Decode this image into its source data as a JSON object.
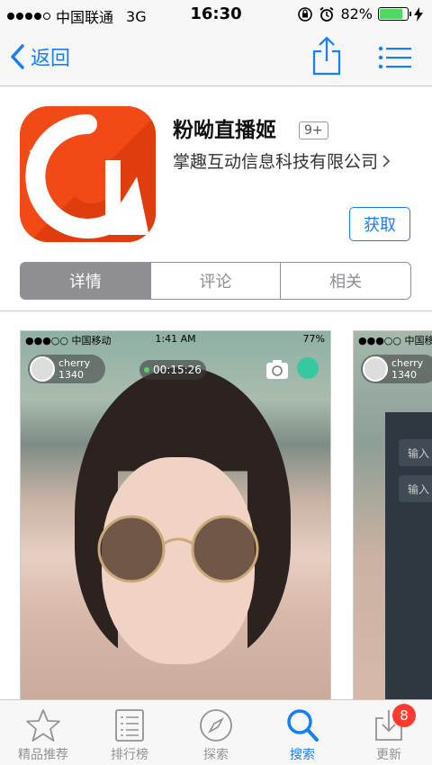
{
  "status_bar": {
    "carrier": "中国联通",
    "network": "3G",
    "time": "16:30",
    "battery": "82%",
    "battery_level": 0.82
  },
  "nav": {
    "back_label": "返回"
  },
  "app": {
    "name": "粉呦直播姬",
    "age_rating": "9+",
    "developer": "掌趣互动信息科技有限公司",
    "get_label": "获取"
  },
  "segments": [
    "详情",
    "评论",
    "相关"
  ],
  "screenshots": [
    {
      "carrier": "●●●○○ 中国移动",
      "time": "1:41 AM",
      "battery": "77%",
      "user_name": "cherry",
      "user_count": "1340",
      "timer": "00:15:26"
    },
    {
      "carrier": "●●●○○ 中国移动",
      "user_name": "cherry",
      "user_count": "1340",
      "input_1": "输入",
      "input_2": "输入"
    }
  ],
  "tabbar": [
    {
      "label": "精品推荐",
      "icon": "star-icon"
    },
    {
      "label": "排行榜",
      "icon": "list-icon"
    },
    {
      "label": "探索",
      "icon": "compass-icon"
    },
    {
      "label": "搜索",
      "icon": "search-icon",
      "active": true
    },
    {
      "label": "更新",
      "icon": "download-icon",
      "badge": "8"
    }
  ],
  "colors": {
    "accent": "#157efb",
    "app_icon": "#f24a16",
    "badge": "#ff3b30",
    "battery": "#4cd964"
  }
}
